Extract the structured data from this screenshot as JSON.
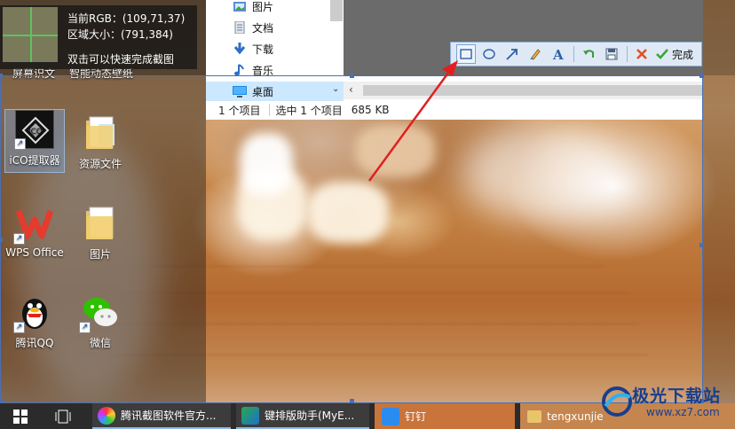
{
  "magnifier": {
    "rgb_label": "当前RGB：(109,71,37)",
    "size_label": "区域大小：(791,384)",
    "hint": "双击可以快速完成截图"
  },
  "desktop_top_labels": {
    "left": "屏幕识文",
    "right": "智能动态壁纸"
  },
  "desktop_icons": [
    {
      "label": "iCO提取器"
    },
    {
      "label": "资源文件"
    },
    {
      "label": "WPS Office"
    },
    {
      "label": "图片"
    },
    {
      "label": "腾讯QQ"
    },
    {
      "label": "微信"
    }
  ],
  "explorer": {
    "nav": [
      {
        "label": "图片",
        "icon": "pictures-icon"
      },
      {
        "label": "文档",
        "icon": "documents-icon"
      },
      {
        "label": "下载",
        "icon": "download-icon"
      },
      {
        "label": "音乐",
        "icon": "music-icon"
      },
      {
        "label": "桌面",
        "icon": "desktop-icon"
      }
    ],
    "status": {
      "items": "1 个项目",
      "selected": "选中 1 个项目",
      "size": "685 KB"
    }
  },
  "screenshot_toolbar": {
    "tools": [
      "rectangle-icon",
      "ellipse-icon",
      "arrow-icon",
      "brush-icon",
      "text-icon",
      "undo-icon",
      "save-icon",
      "cancel-icon"
    ],
    "done_label": "完成",
    "accent_color": "#4a6fb5"
  },
  "taskbar": {
    "items": [
      {
        "label": "腾讯截图软件官方..."
      },
      {
        "label": "键排版助手(MyE..."
      },
      {
        "label": "钉钉"
      },
      {
        "label": "tengxunjie"
      }
    ]
  },
  "watermark": {
    "title": "极光下载站",
    "url": "www.xz7.com"
  }
}
